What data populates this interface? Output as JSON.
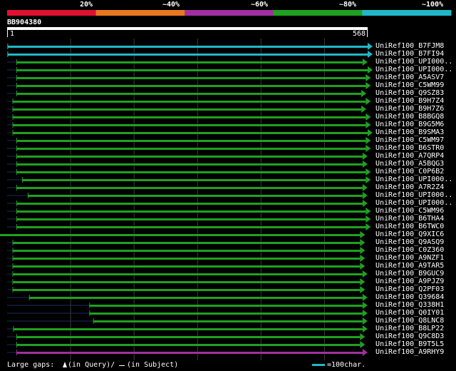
{
  "legend": {
    "percent_labels": [
      "20%",
      "~40%",
      "~60%",
      "~80%",
      "~100%"
    ],
    "colors": [
      "#e01030",
      "#e87820",
      "#a030a0",
      "#20a020",
      "#20b8c8"
    ]
  },
  "query": {
    "name": "BB904380",
    "start_label": "1",
    "end_label": "568",
    "length": 568
  },
  "footer": {
    "gaps_prefix": "Large gaps: ",
    "gaps_query": "(in Query)/",
    "gaps_subject": "(in Subject)",
    "scale_text": "=100char."
  },
  "hits": [
    {
      "name": "UniRef100_B7FJM8",
      "start": 1,
      "end": 568,
      "color": "#20b8c8"
    },
    {
      "name": "UniRef100_B7FI94",
      "start": 1,
      "end": 568,
      "color": "#20b8c8"
    },
    {
      "name": "UniRef100_UPI000..",
      "start": 15,
      "end": 560,
      "color": "#20a020"
    },
    {
      "name": "UniRef100_UPI000..",
      "start": 15,
      "end": 568,
      "color": "#20a020"
    },
    {
      "name": "UniRef100_A5ASV7",
      "start": 15,
      "end": 565,
      "color": "#20a020"
    },
    {
      "name": "UniRef100_C5WM99",
      "start": 15,
      "end": 565,
      "color": "#20a020"
    },
    {
      "name": "UniRef100_Q9SZ83",
      "start": 15,
      "end": 558,
      "color": "#20a020"
    },
    {
      "name": "UniRef100_B9H7Z4",
      "start": 9,
      "end": 565,
      "color": "#20a020"
    },
    {
      "name": "UniRef100_B9H7Z6",
      "start": 9,
      "end": 558,
      "color": "#20a020"
    },
    {
      "name": "UniRef100_B8BGQ8",
      "start": 9,
      "end": 565,
      "color": "#20a020"
    },
    {
      "name": "UniRef100_B9G5M6",
      "start": 9,
      "end": 565,
      "color": "#20a020"
    },
    {
      "name": "UniRef100_B9SMA3",
      "start": 9,
      "end": 568,
      "color": "#20a020"
    },
    {
      "name": "UniRef100_C5WM97",
      "start": 15,
      "end": 565,
      "color": "#20a020"
    },
    {
      "name": "UniRef100_B6STR0",
      "start": 15,
      "end": 565,
      "color": "#20a020"
    },
    {
      "name": "UniRef100_A7QRP4",
      "start": 15,
      "end": 560,
      "color": "#20a020"
    },
    {
      "name": "UniRef100_A5BQG3",
      "start": 15,
      "end": 560,
      "color": "#20a020"
    },
    {
      "name": "UniRef100_C0P6B2",
      "start": 15,
      "end": 565,
      "color": "#20a020"
    },
    {
      "name": "UniRef100_UPI000..",
      "start": 24,
      "end": 565,
      "color": "#20a020"
    },
    {
      "name": "UniRef100_A7R2Z4",
      "start": 15,
      "end": 560,
      "color": "#20a020"
    },
    {
      "name": "UniRef100_UPI000..",
      "start": 33,
      "end": 560,
      "color": "#20a020"
    },
    {
      "name": "UniRef100_UPI000..",
      "start": 15,
      "end": 560,
      "color": "#20a020"
    },
    {
      "name": "UniRef100_C5WM96",
      "start": 15,
      "end": 565,
      "color": "#20a020"
    },
    {
      "name": "UniRef100_B6THA4",
      "start": 15,
      "end": 565,
      "color": "#20a020"
    },
    {
      "name": "UniRef100_B6TWC0",
      "start": 15,
      "end": 565,
      "color": "#20a020"
    },
    {
      "name": "UniRef100_Q9XIC6",
      "start": -22,
      "end": 556,
      "color": "#20a020"
    },
    {
      "name": "UniRef100_Q9ASQ9",
      "start": 9,
      "end": 556,
      "color": "#20a020"
    },
    {
      "name": "UniRef100_C0Z360",
      "start": 9,
      "end": 556,
      "color": "#20a020"
    },
    {
      "name": "UniRef100_A9NZF1",
      "start": 9,
      "end": 556,
      "color": "#20a020"
    },
    {
      "name": "UniRef100_A9TAR5",
      "start": 9,
      "end": 556,
      "color": "#20a020"
    },
    {
      "name": "UniRef100_B9GUC9",
      "start": 9,
      "end": 560,
      "color": "#20a020"
    },
    {
      "name": "UniRef100_A9PJZ9",
      "start": 9,
      "end": 556,
      "color": "#20a020"
    },
    {
      "name": "UniRef100_Q2PF03",
      "start": 9,
      "end": 556,
      "color": "#20a020"
    },
    {
      "name": "UniRef100_Q39684",
      "start": 35,
      "end": 560,
      "color": "#20a020"
    },
    {
      "name": "UniRef100_Q338H1",
      "start": 130,
      "end": 560,
      "color": "#20a020"
    },
    {
      "name": "UniRef100_Q0IY01",
      "start": 130,
      "end": 560,
      "color": "#20a020"
    },
    {
      "name": "UniRef100_Q8LNC8",
      "start": 136,
      "end": 560,
      "color": "#20a020"
    },
    {
      "name": "UniRef100_B8LP22",
      "start": 10,
      "end": 560,
      "color": "#20a020"
    },
    {
      "name": "UniRef100_Q9C8D3",
      "start": 15,
      "end": 556,
      "color": "#20a020"
    },
    {
      "name": "UniRef100_B9T5L5",
      "start": 15,
      "end": 556,
      "color": "#20a020"
    },
    {
      "name": "UniRef100_A9RHY9",
      "start": 15,
      "end": 560,
      "color": "#a030a0"
    }
  ]
}
